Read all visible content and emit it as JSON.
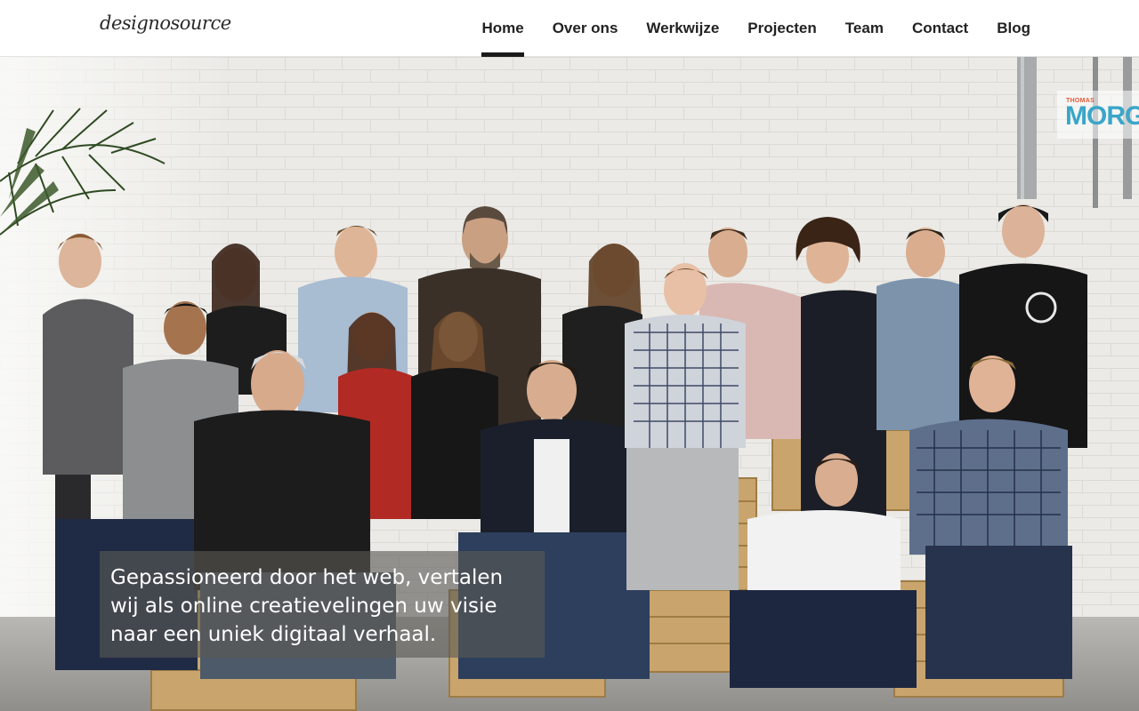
{
  "header": {
    "logo": "designosource",
    "nav": [
      {
        "label": "Home",
        "active": true
      },
      {
        "label": "Over ons",
        "active": false
      },
      {
        "label": "Werkwijze",
        "active": false
      },
      {
        "label": "Projecten",
        "active": false
      },
      {
        "label": "Team",
        "active": false
      },
      {
        "label": "Contact",
        "active": false
      },
      {
        "label": "Blog",
        "active": false
      }
    ]
  },
  "hero": {
    "image": "team-group-photo",
    "caption": "Gepassioneerd door het web, vertalen wij als online creatievelingen uw visie naar een uniek digitaal verhaal.",
    "partner_badge": {
      "small": "THOMAS",
      "big": "MORG"
    }
  },
  "colors": {
    "header_bg": "#ffffff",
    "nav_text": "#222222",
    "active_indicator": "#1a1a1a",
    "wall": "#e9e8e4",
    "caption_bg": "#5a5854"
  }
}
